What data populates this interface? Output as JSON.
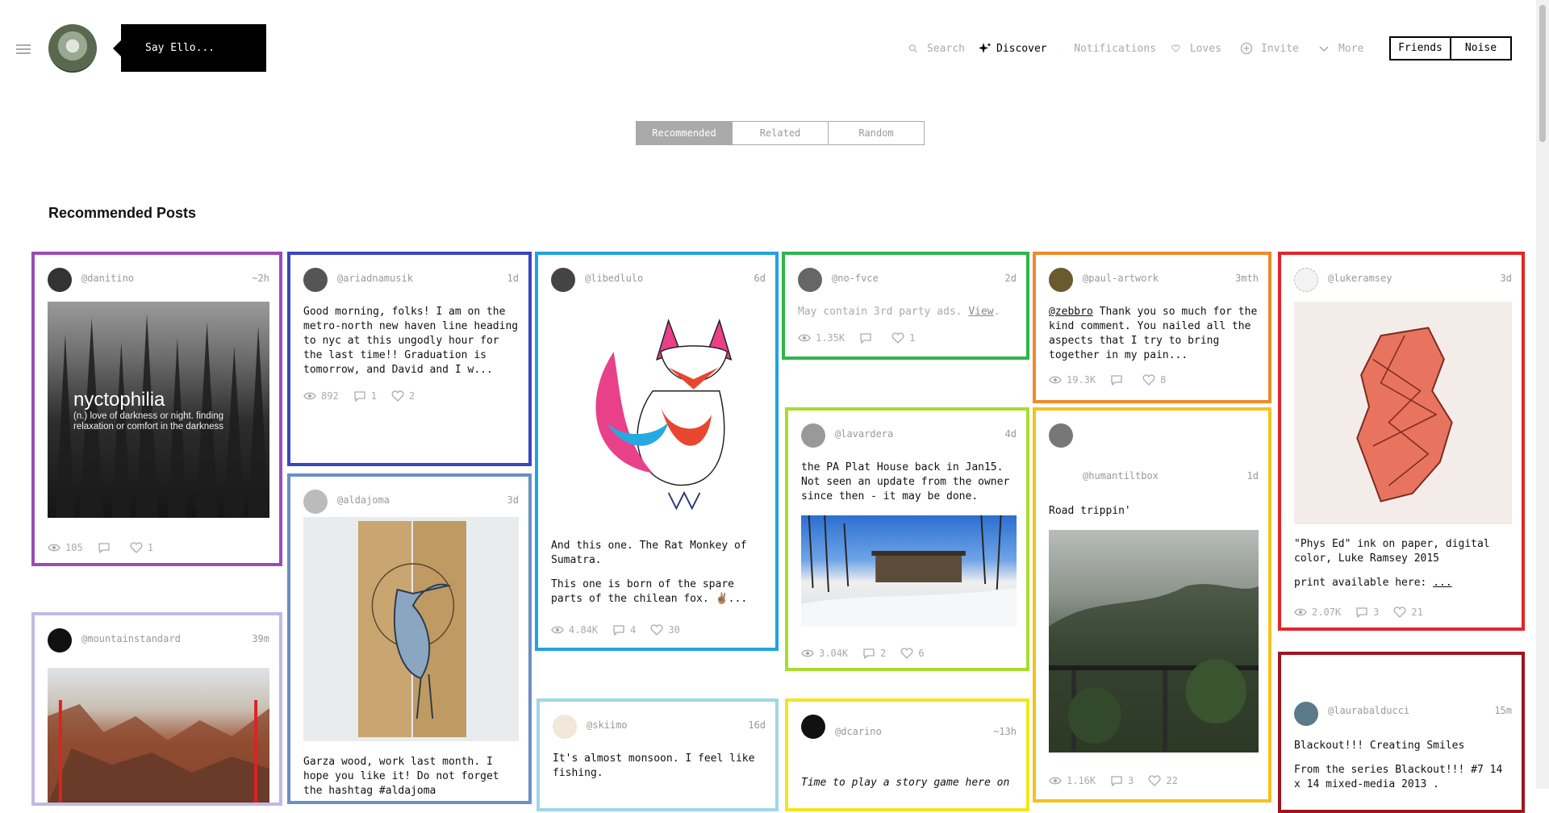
{
  "header": {
    "say_ello": "Say Ello...",
    "nav": {
      "search": "Search",
      "discover": "Discover",
      "notifications": "Notifications",
      "loves": "Loves",
      "invite": "Invite",
      "more": "More"
    },
    "toggle": {
      "friends": "Friends",
      "noise": "Noise"
    }
  },
  "stream_tabs": {
    "recommended": "Recommended",
    "related": "Related",
    "random": "Random"
  },
  "section_title": "Recommended Posts",
  "colors": {
    "purple": "#9b4bb7",
    "indigo": "#3b45c0",
    "sky": "#1fa3e0",
    "green": "#2fb54a",
    "orange": "#f08a2a",
    "red": "#e2252b",
    "lavender": "#c3b8e2",
    "steel": "#6b8fc6",
    "lime": "#a8dc2e",
    "gold": "#f5c21b",
    "yellow": "#f4e51c",
    "pale-blue": "#9fd7e8",
    "maroon": "#a0141f"
  },
  "cards": {
    "danitino": {
      "user": "@danitino",
      "time": "~2h",
      "image_title": "nyctophilia",
      "image_sub": "(n.) love of darkness or night. finding relaxation or comfort in the darkness",
      "views": "105",
      "comments": "",
      "loves": "1"
    },
    "ariadnamusik": {
      "user": "@ariadnamusik",
      "time": "1d",
      "text": "Good morning, folks! I am on the metro-north new haven line heading to nyc at this ungodly hour for the last time!! Graduation is tomorrow, and David and I w...",
      "views": "892",
      "comments": "1",
      "loves": "2"
    },
    "libedlulo": {
      "user": "@libedlulo",
      "time": "6d",
      "text1": "And this one. The Rat Monkey of Sumatra.",
      "text2": "This one is born of the spare parts of the chilean fox. ✌🏽...",
      "views": "4.84K",
      "comments": "4",
      "loves": "30"
    },
    "no_fvce": {
      "user": "@no-fvce",
      "time": "2d",
      "text": "May contain 3rd party ads.",
      "link": "View",
      "views": "1.35K",
      "comments": "",
      "loves": "1"
    },
    "paul_artwork": {
      "user": "@paul-artwork",
      "time": "3mth",
      "mention": "@zebbro",
      "text": " Thank you so much for the kind comment. You nailed all the aspects that I try to bring together in my pain...",
      "views": "19.3K",
      "comments": "",
      "loves": "8"
    },
    "lukeramsey": {
      "user": "@lukeramsey",
      "time": "3d",
      "text1": "\"Phys Ed\" ink on paper, digital color, Luke Ramsey 2015",
      "text2": "print available here:",
      "link": "...",
      "views": "2.07K",
      "comments": "3",
      "loves": "21"
    },
    "aldajoma": {
      "user": "@aldajoma",
      "time": "3d",
      "text": "Garza wood, work last month. I hope you like it! Do not forget the hashtag #aldajoma"
    },
    "lavardera": {
      "user": "@lavardera",
      "time": "4d",
      "text": "the PA Plat House back in Jan15. Not seen an update from the owner since then - it may be done.",
      "views": "3.04K",
      "comments": "2",
      "loves": "6"
    },
    "humantiltbox": {
      "user": "@humantiltbox",
      "time": "1d",
      "text": "Road trippin'",
      "views": "1.16K",
      "comments": "3",
      "loves": "22"
    },
    "mountainstandard": {
      "user": "@mountainstandard",
      "time": "39m"
    },
    "skiimo": {
      "user": "@skiimo",
      "time": "16d",
      "text": "It's almost monsoon. I feel like fishing."
    },
    "dcarino": {
      "user": "@dcarino",
      "time": "~13h",
      "text": "Time to play a story game here on"
    },
    "laurabalducci": {
      "user": "@laurabalducci",
      "time": "15m",
      "text1": "Blackout!!! Creating Smiles",
      "text2": "From the series Blackout!!! #7 14 x 14 mixed-media 2013 ."
    }
  }
}
